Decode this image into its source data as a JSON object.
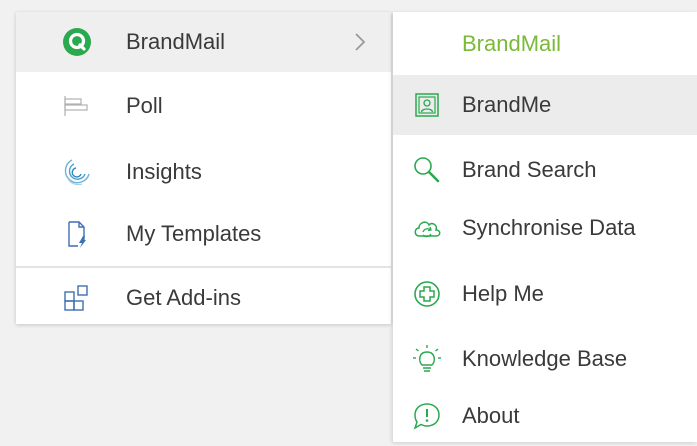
{
  "menu": {
    "items": [
      {
        "label": "BrandMail",
        "icon": "brandmail-logo-icon",
        "has_submenu": true,
        "active": true
      },
      {
        "label": "Poll",
        "icon": "poll-icon"
      },
      {
        "label": "Insights",
        "icon": "insights-icon"
      },
      {
        "label": "My Templates",
        "icon": "templates-icon"
      },
      {
        "label": "Get Add-ins",
        "icon": "add-ins-grid-icon"
      }
    ]
  },
  "submenu": {
    "header": "BrandMail",
    "items": [
      {
        "label": "BrandMe",
        "icon": "brandme-portrait-icon",
        "hover": true
      },
      {
        "label": "Brand Search",
        "icon": "magnifier-icon"
      },
      {
        "label": "Synchronise Data",
        "icon": "cloud-sync-icon"
      },
      {
        "label": "Help Me",
        "icon": "help-plus-icon"
      },
      {
        "label": "Knowledge Base",
        "icon": "lightbulb-icon"
      },
      {
        "label": "About",
        "icon": "about-info-icon"
      }
    ]
  },
  "colors": {
    "brand_green": "#2aa94f",
    "accent_green": "#7cb83a",
    "icon_blue": "#3f6fb5",
    "text": "#3a3a3a"
  }
}
